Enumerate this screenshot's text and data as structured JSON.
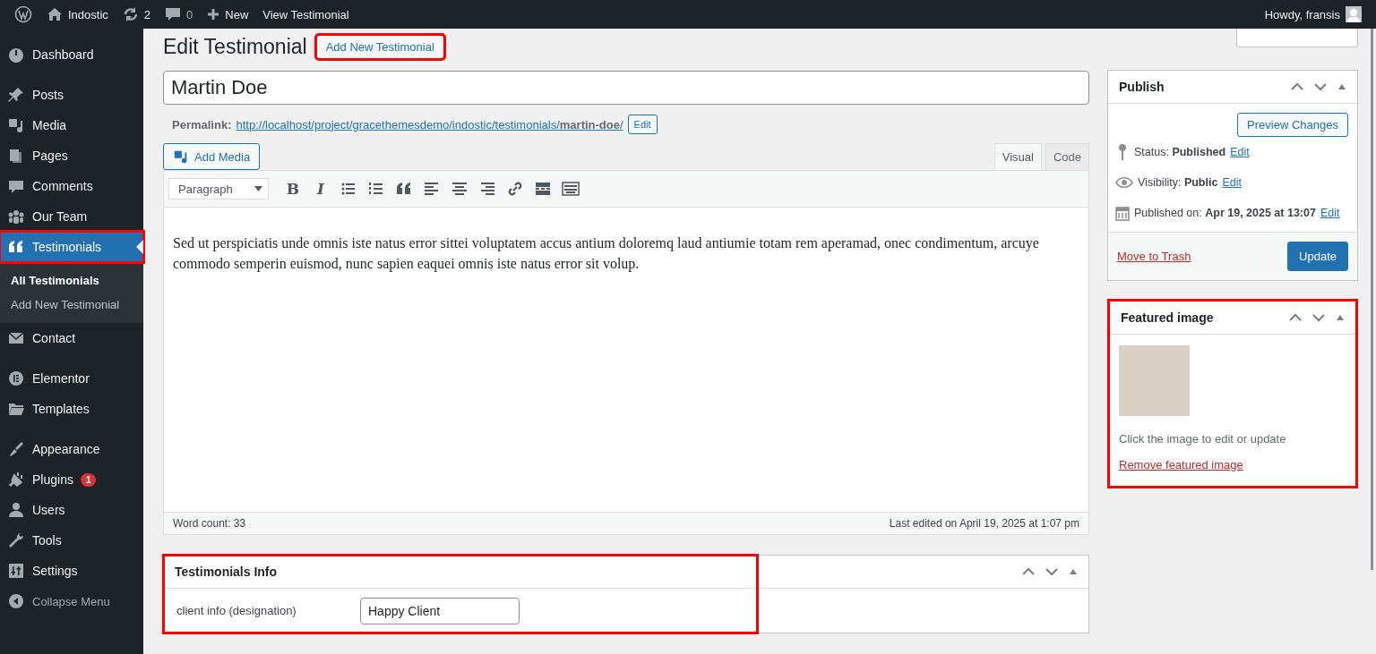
{
  "admin_bar": {
    "site": "Indostic",
    "updates": "2",
    "comments": "0",
    "new": "New",
    "view": "View Testimonial",
    "greeting": "Howdy, fransis"
  },
  "sidebar": {
    "items": [
      {
        "kind": "item",
        "label": "Dashboard",
        "selected": false
      },
      {
        "kind": "separator"
      },
      {
        "kind": "item",
        "label": "Posts",
        "selected": false
      },
      {
        "kind": "item",
        "label": "Media",
        "selected": false
      },
      {
        "kind": "item",
        "label": "Pages",
        "selected": false
      },
      {
        "kind": "item",
        "label": "Comments",
        "selected": false
      },
      {
        "kind": "item",
        "label": "Our Team",
        "selected": false
      },
      {
        "kind": "item",
        "label": "Testimonials",
        "selected": true,
        "highlight": true,
        "children": [
          {
            "label": "All Testimonials",
            "selected": true
          },
          {
            "label": "Add New Testimonial",
            "selected": false
          }
        ]
      },
      {
        "kind": "item",
        "label": "Contact",
        "selected": false
      },
      {
        "kind": "separator"
      },
      {
        "kind": "item",
        "label": "Elementor",
        "selected": false
      },
      {
        "kind": "item",
        "label": "Templates",
        "selected": false
      },
      {
        "kind": "separator"
      },
      {
        "kind": "item",
        "label": "Appearance",
        "selected": false
      },
      {
        "kind": "item",
        "label": "Plugins",
        "selected": false,
        "badge": "1"
      },
      {
        "kind": "item",
        "label": "Users",
        "selected": false
      },
      {
        "kind": "item",
        "label": "Tools",
        "selected": false
      },
      {
        "kind": "item",
        "label": "Settings",
        "selected": false
      },
      {
        "kind": "collapse",
        "label": "Collapse Menu"
      }
    ]
  },
  "heading": {
    "title": "Edit Testimonial",
    "add_button": "Add New Testimonial",
    "highlight": true
  },
  "post_title": "Martin Doe",
  "permalink": {
    "label": "Permalink:",
    "url": "http://localhost/project/gracethemesdemo/indostic/testimonials/**martin-doe**/",
    "edit": "Edit"
  },
  "editor": {
    "add_media": "Add Media",
    "tabs": [
      {
        "label": "Visual",
        "selected": true
      },
      {
        "label": "Code",
        "selected": false
      }
    ],
    "format": "Paragraph",
    "toolbar": [
      {
        "kind": "text",
        "text": "B"
      },
      {
        "kind": "text",
        "text": "I"
      },
      {
        "kind": "icon"
      },
      {
        "kind": "icon"
      },
      {
        "kind": "icon"
      },
      {
        "kind": "icon"
      },
      {
        "kind": "icon"
      },
      {
        "kind": "icon"
      },
      {
        "kind": "icon"
      },
      {
        "kind": "icon"
      },
      {
        "kind": "icon"
      }
    ],
    "content": "Sed ut perspiciatis unde omnis iste natus error sittei voluptatem accus antium doloremq laud antiumie totam rem aperamad, onec condimentum, arcuye commodo semperin euismod, nunc sapien eaquei omnis iste natus error sit volup.",
    "word_count": "Word count: 33",
    "last_edited": "Last edited on April 19, 2025 at 1:07 pm"
  },
  "testimonials_info": {
    "title": "Testimonials Info",
    "highlight": true,
    "fields": [
      {
        "label": "client info (designation)",
        "value": "Happy Client"
      }
    ]
  },
  "publish": {
    "title": "Publish",
    "preview": "Preview Changes",
    "rows": [
      {
        "text": "Status: **Published**",
        "link": "Edit"
      },
      {
        "text": "Visibility: **Public**",
        "link": "Edit"
      },
      {
        "text": "Published on: **Apr 19, 2025 at 13:07**",
        "link": "Edit"
      }
    ],
    "trash": "Move to Trash",
    "update": "Update"
  },
  "featured_image": {
    "title": "Featured image",
    "highlight": true,
    "hint": "Click the image to edit or update",
    "remove": "Remove featured image"
  }
}
